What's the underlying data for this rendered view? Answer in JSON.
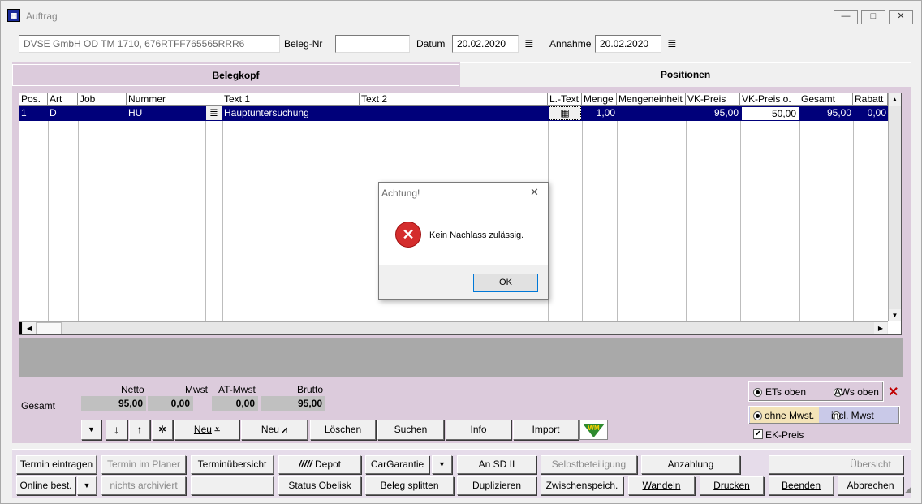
{
  "window": {
    "title": "Auftrag",
    "minimize": "—",
    "restore": "□",
    "close": "✕"
  },
  "header": {
    "customer": "DVSE GmbH OD TM 1710, 676RTFF765565RRR6",
    "beleg_label": "Beleg-Nr",
    "beleg_value": "",
    "datum_label": "Datum",
    "datum_value": "20.02.2020",
    "annahme_label": "Annahme",
    "annahme_value": "20.02.2020"
  },
  "tabs": {
    "belegkopf": "Belegkopf",
    "positionen": "Positionen"
  },
  "grid": {
    "columns": [
      "Pos.",
      "Art",
      "Job",
      "Nummer",
      "",
      "Text 1",
      "Text 2",
      "L.-Text",
      "Menge",
      "Mengeneinheit",
      "VK-Preis",
      "VK-Preis o.",
      "Gesamt",
      "Rabatt"
    ],
    "row": {
      "pos": "1",
      "art": "D",
      "job": "",
      "nummer": "HU",
      "text1": "Hauptuntersuchung",
      "text2": "",
      "menge": "1,00",
      "einheit": "",
      "vk_preis": "95,00",
      "vk_preis_o": "50,00",
      "gesamt": "95,00",
      "rabatt": "0,00"
    }
  },
  "dialog": {
    "title": "Achtung!",
    "message": "Kein Nachlass zulässig.",
    "ok": "OK",
    "close": "✕"
  },
  "totals": {
    "gesamt_label": "Gesamt",
    "netto_label": "Netto",
    "netto": "95,00",
    "mwst_label": "Mwst",
    "mwst": "0,00",
    "atmwst_label": "AT-Mwst",
    "atmwst": "0,00",
    "brutto_label": "Brutto",
    "brutto": "95,00"
  },
  "toolbar": {
    "neu1": "Neu",
    "neu2": "Neu",
    "loeschen": "Löschen",
    "suchen": "Suchen",
    "info": "Info",
    "import": "Import",
    "wm": "WM"
  },
  "options": {
    "ets_oben": "ETs oben",
    "aws_oben": "AWs oben",
    "ohne_mwst": "ohne Mwst.",
    "incl_mwst": "incl. Mwst",
    "ek_preis": "EK-Preis"
  },
  "buttons_row1": {
    "termin_eintragen": "Termin eintragen",
    "termin_planer": "Termin im Planer",
    "terminuebersicht": "Terminübersicht",
    "depot": "Depot",
    "cargarantie": "CarGarantie",
    "an_sd": "An SD II",
    "selbstbeteiligung": "Selbstbeteiligung",
    "anzahlung": "Anzahlung",
    "blank": "",
    "uebersicht": "Übersicht"
  },
  "buttons_row2": {
    "online_best": "Online best.",
    "nichts_archiviert": "nichts archiviert",
    "blank": "",
    "status_obelisk": "Status Obelisk",
    "beleg_splitten": "Beleg splitten",
    "duplizieren": "Duplizieren",
    "zwischenspeich": "Zwischenspeich.",
    "wandeln": "Wandeln",
    "drucken": "Drucken",
    "beenden": "Beenden",
    "abbrechen": "Abbrechen"
  }
}
